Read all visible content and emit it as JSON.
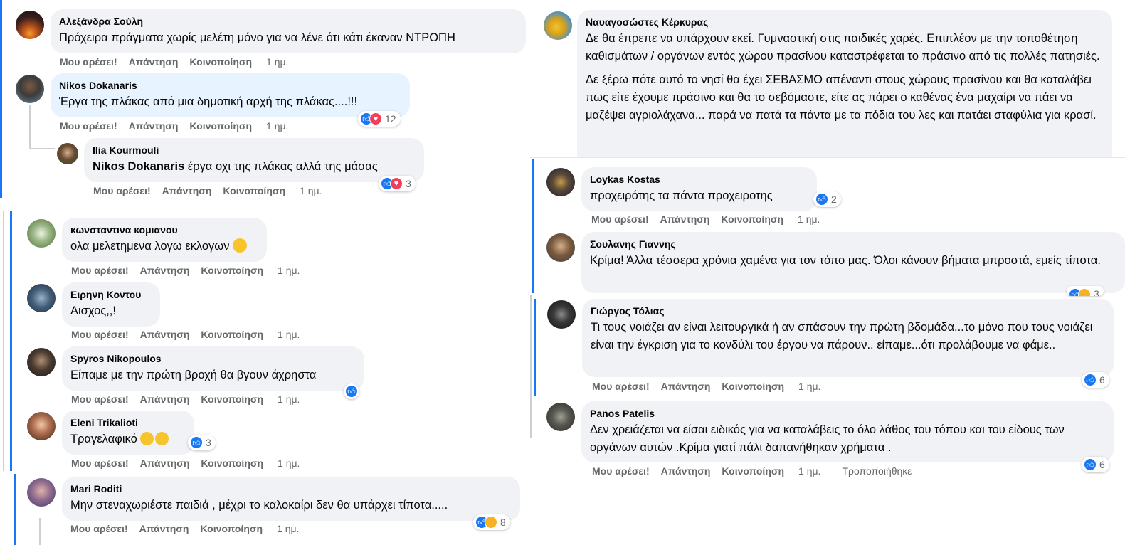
{
  "actions": {
    "like": "Μου αρέσει!",
    "reply": "Απάντηση",
    "share": "Κοινοποίηση",
    "edited": "Τροποποιήθηκε"
  },
  "comments": [
    {
      "author": "Αλεξάνδρα Σούλη",
      "text": "Πρόχειρα πράγματα χωρίς μελέτη μόνο για να λένε ότι κάτι έκαναν ΝΤΡΟΠΗ",
      "time": "1 ημ."
    },
    {
      "author": "Nikos Dokanaris",
      "text": "Έργα της πλάκας από μια δημοτική αρχή της πλάκας....!!!",
      "time": "1 ημ.",
      "reactions": "12"
    },
    {
      "author": "Ilia Kourmouli",
      "mention": "Nikos Dokanaris",
      "text": " έργα οχι της πλάκας αλλά της μάσας",
      "time": "1 ημ.",
      "reactions": "3"
    },
    {
      "author": "κωνσταντινα κομιανου",
      "text": "ολα μελετημενα λογω εκλογων",
      "time": "1 ημ."
    },
    {
      "author": "Ειρηνη Κοντου",
      "text": "Αισχος,,!",
      "time": "1 ημ."
    },
    {
      "author": "Spyros Nikopoulos",
      "text": "Είπαμε με την πρώτη βροχή θα βγουν άχρηστα",
      "time": "1 ημ."
    },
    {
      "author": "Eleni Trikalioti",
      "text": "Τραγελαφικό",
      "time": "1 ημ.",
      "reactions": "3"
    },
    {
      "author": "Mari Roditi",
      "text": "Μην στεναχωριέστε παιδιά , μέχρι το καλοκαίρι δεν θα υπάρχει τίποτα.....",
      "time": "1 ημ.",
      "reactions": "8"
    },
    {
      "author": "Ναυαγοσώστες Κέρκυρας",
      "text1": "Δε θα έπρεπε να υπάρχουν εκεί. Γυμναστική στις παιδικές χαρές. Επιπλέον με την τοποθέτηση καθισμάτων / οργάνων εντός χώρου πρασίνου καταστρέφεται το πράσινο από τις πολλές πατησιές.",
      "text2": "Δε ξέρω πότε αυτό το νησί θα έχει ΣΕΒΑΣΜΟ απέναντι στους χώρους πρασίνου και θα καταλάβει πως είτε έχουμε πράσινο και θα το σεβόμαστε, είτε ας πάρει ο καθένας ένα μαχαίρι να πάει να μαζέψει αγριολάχανα... παρά να πατά τα πάντα με τα πόδια του λες και πατάει σταφύλια για κρασί."
    },
    {
      "author": "Loykas Kostas",
      "text": "προχειρότης τα πάντα προχειροτης",
      "time": "1 ημ.",
      "reactions": "2"
    },
    {
      "author": "Σουλανης Γιαννης",
      "text": "Κρίμα! Άλλα τέσσερα χρόνια χαμένα για τον τόπο μας. Όλοι κάνουν βήματα μπροστά, εμείς τίποτα.",
      "reactions": "3"
    },
    {
      "author": "Γιώργος Τόλιας",
      "text": "Τι τους νοιάζει αν είναι λειτουργικά ή αν σπάσουν την πρώτη βδομάδα...το μόνο που τους νοιάζει είναι την έγκριση για το κονδύλι του έργου να πάρουν.. είπαμε...ότι προλάβουμε να φάμε..",
      "time": "1 ημ.",
      "reactions": "6"
    },
    {
      "author": "Panos Patelis",
      "text": "Δεν χρειάζεται να είσαι ειδικός για να καταλάβεις το όλο λάθος του τόπου και του είδους των οργάνων αυτών .Κρίμα γιατί πάλι δαπανήθηκαν χρήματα .",
      "time": "1 ημ.",
      "reactions": "6"
    }
  ],
  "colors": {
    "accent": "#1877f2",
    "bubble": "#f0f2f5",
    "highlight": "#e7f3ff",
    "meta": "#65676b"
  }
}
